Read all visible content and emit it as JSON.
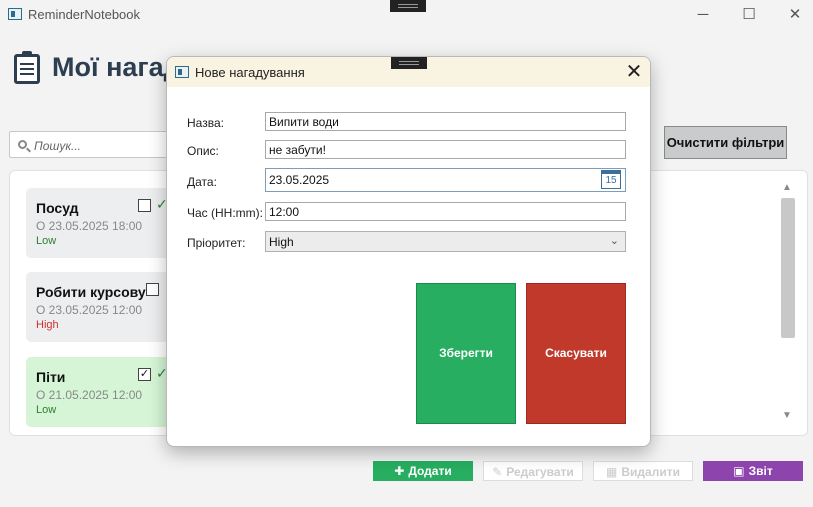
{
  "window": {
    "title": "ReminderNotebook"
  },
  "header": {
    "title": "Мої нагадування"
  },
  "search": {
    "placeholder": "Пошук..."
  },
  "filters": {
    "clear_label": "Очистити фільтри"
  },
  "reminders": [
    {
      "title": "Посуд",
      "datetime": "О 23.05.2025 18:00",
      "priority": "Low",
      "done": false
    },
    {
      "title": "Робити курсову",
      "datetime": "О 23.05.2025 12:00",
      "priority": "High",
      "done": false
    },
    {
      "title": "Піти",
      "datetime": "О 21.05.2025 12:00",
      "priority": "Low",
      "done": true
    }
  ],
  "actions": {
    "add_label": "Додати",
    "edit_label": "Редагувати",
    "delete_label": "Видалити",
    "report_label": "Звіт"
  },
  "dialog": {
    "title": "Нове нагадування",
    "name_label": "Назва:",
    "name_value": "Випити води",
    "desc_label": "Опис:",
    "desc_value": "не забути!",
    "date_label": "Дата:",
    "date_value": "23.05.2025",
    "calendar_day": "15",
    "time_label": "Час (HH:mm):",
    "time_value": "12:00",
    "priority_label": "Пріоритет:",
    "priority_value": "High",
    "save_label": "Зберегти",
    "cancel_label": "Скасувати"
  },
  "colors": {
    "add": "#27ae60",
    "save": "#27ae60",
    "cancel": "#c0392b",
    "report": "#8e44ad",
    "title": "#2c3e50",
    "done_card": "#d6f5d6"
  }
}
